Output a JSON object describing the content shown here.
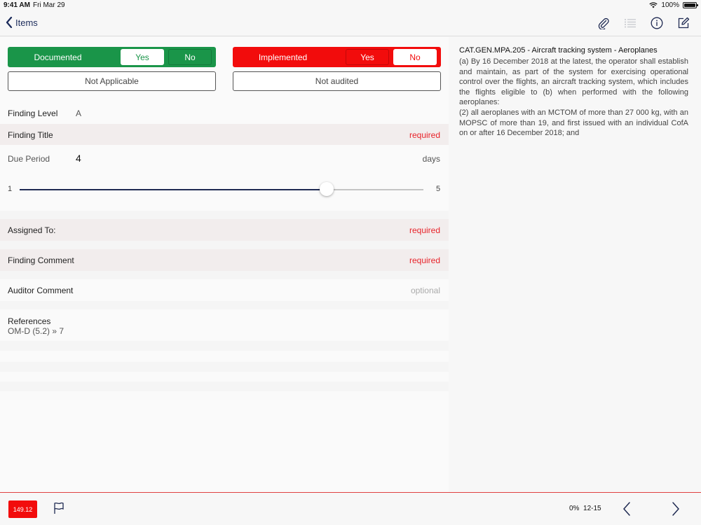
{
  "status_bar": {
    "time": "9:41 AM",
    "date": "Fri Mar 29",
    "battery": "100%"
  },
  "nav": {
    "back_label": "Items",
    "icons": [
      "paperclip-icon",
      "list-icon",
      "info-icon",
      "edit-icon"
    ]
  },
  "documented": {
    "label": "Documented",
    "yes": "Yes",
    "no": "No",
    "selected": "Yes"
  },
  "implemented": {
    "label": "Implemented",
    "yes": "Yes",
    "no": "No",
    "selected": "No"
  },
  "buttons": {
    "not_applicable": "Not Applicable",
    "not_audited": "Not audited"
  },
  "finding_level": {
    "label": "Finding Level",
    "value": "A"
  },
  "finding_title": {
    "label": "Finding Title",
    "hint": "required"
  },
  "due_period": {
    "label": "Due Period",
    "value": "4",
    "unit": "days",
    "min": "1",
    "max": "5",
    "slider_fraction": 0.76
  },
  "assigned_to": {
    "label": "Assigned To:",
    "hint": "required"
  },
  "finding_comment": {
    "label": "Finding Comment",
    "hint": "required"
  },
  "auditor_comment": {
    "label": "Auditor Comment",
    "hint": "optional"
  },
  "references": {
    "label": "References",
    "value": "OM-D (5.2) » 7"
  },
  "regulation": {
    "title": "CAT.GEN.MPA.205 - Aircraft tracking system - Aeroplanes",
    "body_lines": [
      "(a) By 16 December 2018 at the latest, the operator shall establish and maintain, as part of the system for exercising operational control over the flights, an aircraft tracking system, which includes the flights eligible to (b) when performed with the following aeroplanes:",
      "(2) all aeroplanes with an MCTOM of more than 27 000 kg, with an MOPSC of more than 19, and first issued with an individual CofA on or after 16 December 2018; and"
    ]
  },
  "bottom": {
    "badge": "149.12",
    "progress": "0%",
    "range": "12-15"
  },
  "colors": {
    "green": "#1a9549",
    "red": "#f20c0c",
    "navy": "#1f2a52",
    "required": "#e8232a"
  }
}
